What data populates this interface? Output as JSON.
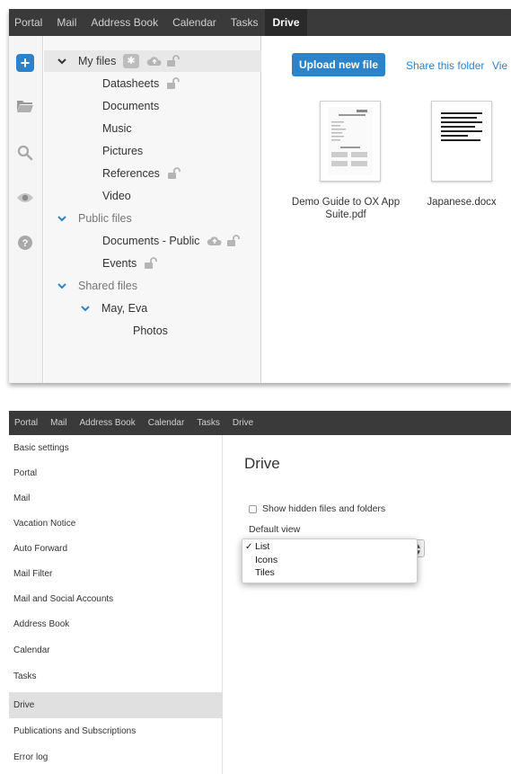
{
  "drive_view": {
    "topbar": {
      "tabs": [
        {
          "label": "Portal"
        },
        {
          "label": "Mail"
        },
        {
          "label": "Address Book"
        },
        {
          "label": "Calendar"
        },
        {
          "label": "Tasks"
        },
        {
          "label": "Drive",
          "active": true
        }
      ]
    },
    "sidebar_icons": [
      "plus-icon",
      "folder-icon",
      "search-icon",
      "eye-icon",
      "help-icon"
    ],
    "folder_tree": {
      "my_files": "My files",
      "my_files_children": [
        "Datasheets",
        "Documents",
        "Music",
        "Pictures",
        "References",
        "Video"
      ],
      "public_files": "Public files",
      "public_children": [
        "Documents - Public",
        "Events"
      ],
      "shared_files": "Shared files",
      "shared_user": "May, Eva",
      "shared_user_children": [
        "Photos"
      ]
    },
    "toolbar": {
      "upload_label": "Upload new file",
      "share_label": "Share this folder",
      "view_label": "Vie"
    },
    "files": [
      {
        "name_line1": "Demo Guide to OX App",
        "name_line2": "Suite.pdf"
      },
      {
        "name_line1": "Japanese.docx",
        "name_line2": ""
      }
    ]
  },
  "settings_view": {
    "topbar": {
      "tabs": [
        {
          "label": "Portal"
        },
        {
          "label": "Mail"
        },
        {
          "label": "Address Book"
        },
        {
          "label": "Calendar"
        },
        {
          "label": "Tasks"
        },
        {
          "label": "Drive"
        }
      ]
    },
    "nav_items": [
      "Basic settings",
      "Portal",
      "Mail",
      "Vacation Notice",
      "Auto Forward",
      "Mail Filter",
      "Mail and Social Accounts",
      "Address Book",
      "Calendar",
      "Tasks",
      "Drive",
      "Publications and Subscriptions",
      "Error log"
    ],
    "active_item": "Drive",
    "title": "Drive",
    "show_hidden_label": "Show hidden files and folders",
    "default_view_label": "Default view",
    "dropdown": {
      "options": [
        "List",
        "Icons",
        "Tiles"
      ],
      "selected": "List",
      "check_mark": "✓"
    }
  },
  "colors": {
    "accent": "#2c83c9",
    "topbar": "#3a3a3a",
    "active_nav": "#e0e0e0"
  }
}
